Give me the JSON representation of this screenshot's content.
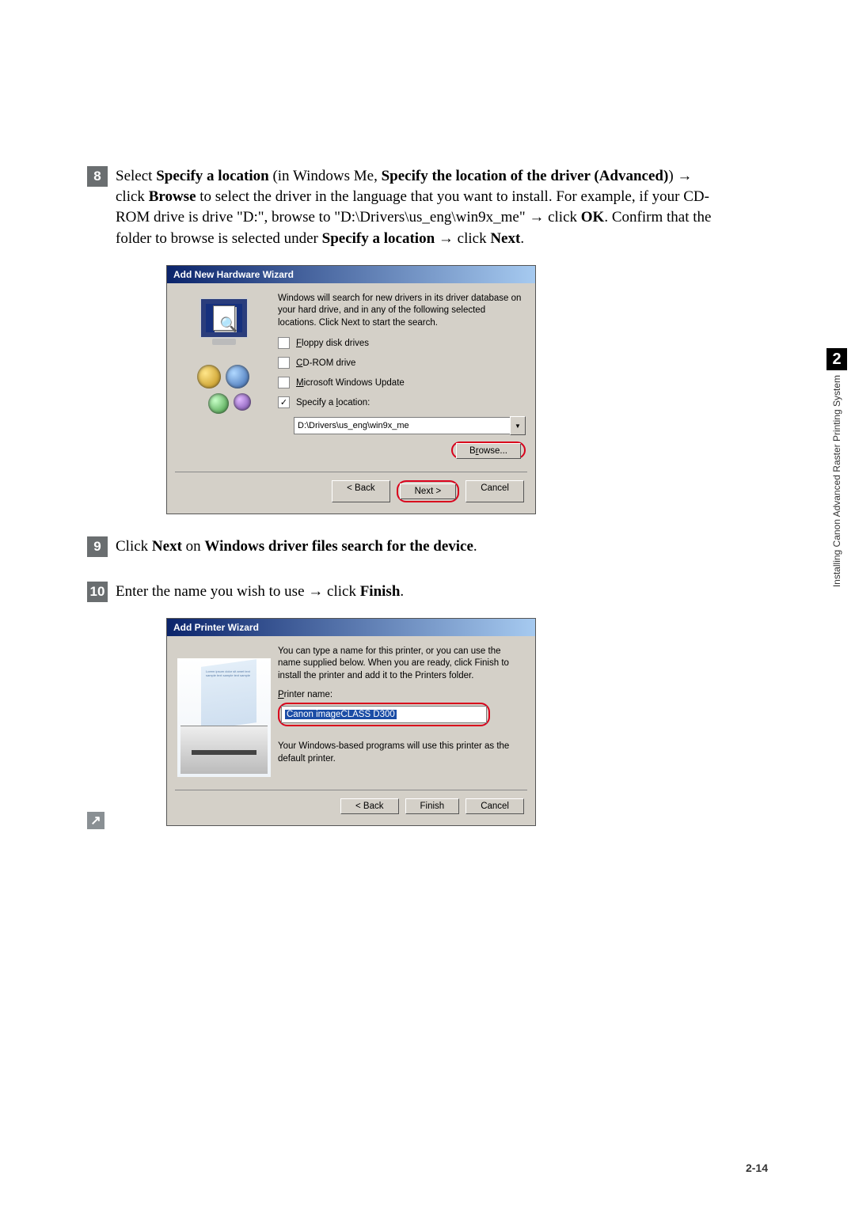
{
  "steps": {
    "s8": {
      "num": "8",
      "pre": "Select ",
      "b1": "Specify a location",
      "mid1": " (in Windows Me, ",
      "b2": "Specify the location of the driver (Advanced)",
      "mid2": ") ",
      "arrow": "→",
      "mid3": " click ",
      "b3": "Browse",
      "mid4": " to select the driver in the language that you want to install. For example, if your CD-ROM drive is drive \"D:\", browse to \"",
      "path": "D:\\Drivers\\us_eng\\win9x_me",
      "mid5": "\" ",
      "mid6": " click ",
      "b4": "OK",
      "mid7": ". Confirm that the folder to browse is selected under ",
      "b5": "Specify a location",
      "mid8": " ",
      "mid9": " click ",
      "b6": "Next",
      "end": "."
    },
    "s9": {
      "num": "9",
      "pre": "Click ",
      "b1": "Next",
      "mid": " on ",
      "b2": "Windows driver files search for the device",
      "end": "."
    },
    "s10": {
      "num": "10",
      "pre": "Enter the name you wish to use ",
      "arrow": "→",
      "mid": " click ",
      "b1": "Finish",
      "end": "."
    }
  },
  "dialog1": {
    "title": "Add New Hardware Wizard",
    "intro": "Windows will search for new drivers in its driver database on your hard drive, and in any of the following selected locations. Click Next to start the search.",
    "opt_floppy": "Floppy disk drives",
    "opt_cd": "CD-ROM drive",
    "opt_msupdate": "Microsoft Windows Update",
    "opt_specify": "Specify a location:",
    "location_value": "D:\\Drivers\\us_eng\\win9x_me",
    "browse": "Browse...",
    "back": "< Back",
    "next": "Next >",
    "cancel": "Cancel",
    "checkmark": "✓"
  },
  "dialog2": {
    "title": "Add Printer Wizard",
    "intro": "You can type a name for this printer, or you can use the name supplied below. When you are ready, click Finish to install the printer and add it to the Printers folder.",
    "pname_label": "Printer name:",
    "pname_value": "Canon imageCLASS D300",
    "default_note": "Your Windows-based programs will use this printer as the default printer.",
    "back": "< Back",
    "finish": "Finish",
    "cancel": "Cancel"
  },
  "side": {
    "chapter": "2",
    "label": "Installing Canon Advanced Raster Printing System"
  },
  "page_number": "2-14",
  "return_glyph": "↗"
}
